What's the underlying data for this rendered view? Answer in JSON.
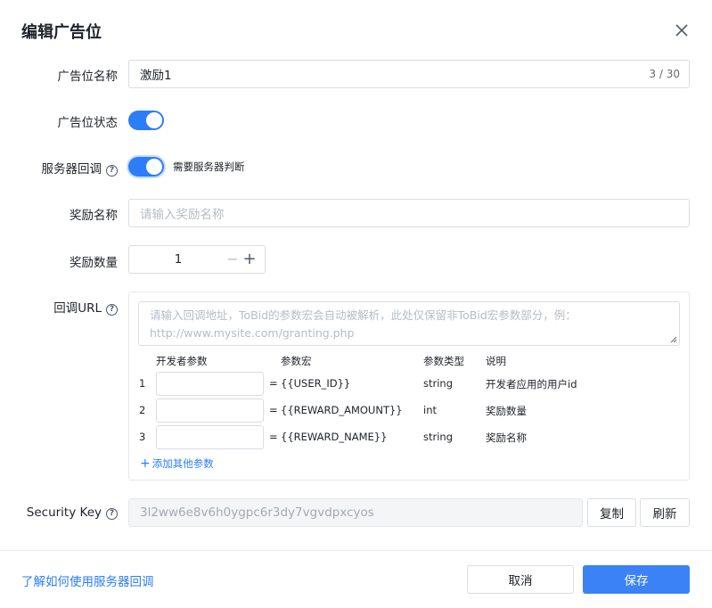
{
  "dialog": {
    "title": "编辑广告位"
  },
  "form": {
    "name": {
      "label": "广告位名称",
      "value": "激励1",
      "counter": "3 / 30"
    },
    "status": {
      "label": "广告位状态",
      "on": true
    },
    "callback": {
      "label": "服务器回调",
      "on": true,
      "hint": "需要服务器判断"
    },
    "reward_name": {
      "label": "奖励名称",
      "placeholder": "请输入奖励名称"
    },
    "reward_amount": {
      "label": "奖励数量",
      "value": "1",
      "minus": "−",
      "plus": "+"
    },
    "callback_url": {
      "label": "回调URL",
      "placeholder": "请输入回调地址，ToBid的参数宏会自动被解析，此处仅保留非ToBid宏参数部分，例：http://www.mysite.com/granting.php",
      "headers": [
        "开发者参数",
        "参数宏",
        "参数类型",
        "说明"
      ],
      "rows": [
        {
          "index": "1",
          "eq": "=",
          "macro": "{{USER_ID}}",
          "type": "string",
          "desc": "开发者应用的用户id"
        },
        {
          "index": "2",
          "eq": "=",
          "macro": "{{REWARD_AMOUNT}}",
          "type": "int",
          "desc": "奖励数量"
        },
        {
          "index": "3",
          "eq": "=",
          "macro": "{{REWARD_NAME}}",
          "type": "string",
          "desc": "奖励名称"
        }
      ],
      "add_label": "添加其他参数"
    },
    "security_key": {
      "label": "Security Key",
      "value": "3l2ww6e8v6h0ygpc6r3dy7vgvdpxcyos",
      "copy_label": "复制",
      "refresh_label": "刷新"
    }
  },
  "footer": {
    "learn_link": "了解如何使用服务器回调",
    "cancel_label": "取消",
    "save_label": "保存"
  },
  "colors": {
    "accent": "#2b7ef5",
    "primary_button": "#3b82f6",
    "border": "#d9dde3"
  },
  "icons": {
    "help": "?",
    "add": "+"
  }
}
